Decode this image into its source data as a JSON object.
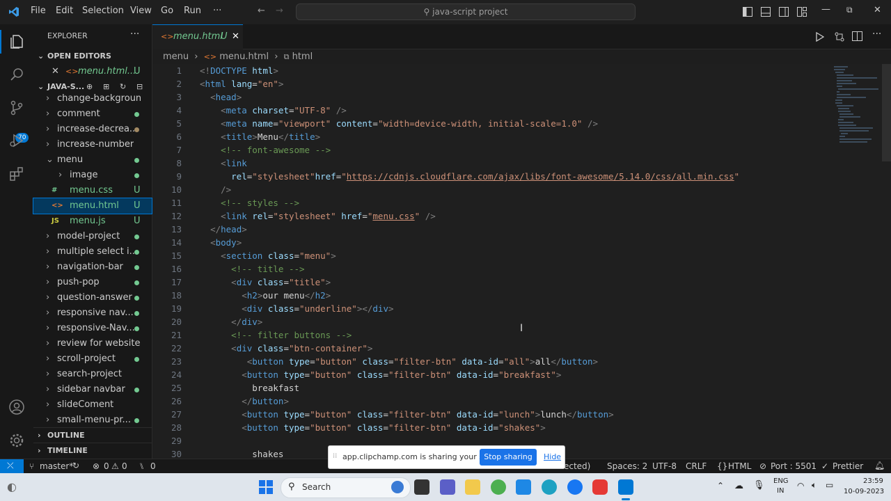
{
  "titlebar": {
    "menus": [
      "File",
      "Edit",
      "Selection",
      "View",
      "Go",
      "Run",
      "···"
    ],
    "search": "java-script project"
  },
  "sidebar": {
    "title": "EXPLORER",
    "more": "···",
    "open_editors": "OPEN EDITORS",
    "open_file": "menu.html...",
    "open_file_status": "U",
    "project": "JAVA-S...",
    "items": [
      {
        "label": "change-background-...",
        "indent": 0,
        "chev": ">"
      },
      {
        "label": "comment",
        "indent": 0,
        "chev": ">",
        "dot": "green"
      },
      {
        "label": "increase-decrea...",
        "indent": 0,
        "chev": ">",
        "dot": "brown"
      },
      {
        "label": "increase-number",
        "indent": 0,
        "chev": ">"
      },
      {
        "label": "menu",
        "indent": 0,
        "chev": "v",
        "dot": "green"
      },
      {
        "label": "image",
        "indent": 1,
        "chev": ">",
        "dot": "green"
      },
      {
        "label": "menu.css",
        "indent": 1,
        "icon": "#",
        "status": "U"
      },
      {
        "label": "menu.html",
        "indent": 1,
        "icon": "<>",
        "status": "U",
        "selected": true
      },
      {
        "label": "menu.js",
        "indent": 1,
        "icon": "JS",
        "status": "U"
      },
      {
        "label": "model-project",
        "indent": 0,
        "chev": ">",
        "dot": "green"
      },
      {
        "label": "multiple select i...",
        "indent": 0,
        "chev": ">",
        "dot": "green"
      },
      {
        "label": "navigation-bar",
        "indent": 0,
        "chev": ">",
        "dot": "green"
      },
      {
        "label": "push-pop",
        "indent": 0,
        "chev": ">",
        "dot": "green"
      },
      {
        "label": "question-answer",
        "indent": 0,
        "chev": ">",
        "dot": "green"
      },
      {
        "label": "responsive nav...",
        "indent": 0,
        "chev": ">",
        "dot": "green"
      },
      {
        "label": "responsive-Nav...",
        "indent": 0,
        "chev": ">",
        "dot": "green"
      },
      {
        "label": "review for website",
        "indent": 0,
        "chev": ">"
      },
      {
        "label": "scroll-project",
        "indent": 0,
        "chev": ">",
        "dot": "green"
      },
      {
        "label": "search-project",
        "indent": 0,
        "chev": ">"
      },
      {
        "label": "sidebar navbar",
        "indent": 0,
        "chev": ">",
        "dot": "green"
      },
      {
        "label": "slideComent",
        "indent": 0,
        "chev": ">"
      },
      {
        "label": "small-menu-pr...",
        "indent": 0,
        "chev": ">",
        "dot": "green"
      }
    ],
    "outline": "OUTLINE",
    "timeline": "TIMELINE"
  },
  "activity": {
    "badge": "70"
  },
  "tab": {
    "label": "menu.html",
    "status": "U",
    "close": "✕"
  },
  "breadcrumb": [
    "menu",
    "menu.html",
    "html"
  ],
  "code": [
    [
      [
        "br",
        "<!"
      ],
      [
        "tg",
        "DOCTYPE"
      ],
      [
        "tx",
        " "
      ],
      [
        "at",
        "html"
      ],
      [
        "br",
        ">"
      ]
    ],
    [
      [
        "br",
        "<"
      ],
      [
        "tg",
        "html"
      ],
      [
        "tx",
        " "
      ],
      [
        "at",
        "lang"
      ],
      [
        "tx",
        "="
      ],
      [
        "st",
        "\"en\""
      ],
      [
        "br",
        ">"
      ]
    ],
    [
      [
        "tx",
        "  "
      ],
      [
        "br",
        "<"
      ],
      [
        "tg",
        "head"
      ],
      [
        "br",
        ">"
      ]
    ],
    [
      [
        "tx",
        "    "
      ],
      [
        "br",
        "<"
      ],
      [
        "tg",
        "meta"
      ],
      [
        "tx",
        " "
      ],
      [
        "at",
        "charset"
      ],
      [
        "tx",
        "="
      ],
      [
        "st",
        "\"UTF-8\""
      ],
      [
        "tx",
        " "
      ],
      [
        "br",
        "/>"
      ]
    ],
    [
      [
        "tx",
        "    "
      ],
      [
        "br",
        "<"
      ],
      [
        "tg",
        "meta"
      ],
      [
        "tx",
        " "
      ],
      [
        "at",
        "name"
      ],
      [
        "tx",
        "="
      ],
      [
        "st",
        "\"viewport\""
      ],
      [
        "tx",
        " "
      ],
      [
        "at",
        "content"
      ],
      [
        "tx",
        "="
      ],
      [
        "st",
        "\"width=device-width, initial-scale=1.0\""
      ],
      [
        "tx",
        " "
      ],
      [
        "br",
        "/>"
      ]
    ],
    [
      [
        "tx",
        "    "
      ],
      [
        "br",
        "<"
      ],
      [
        "tg",
        "title"
      ],
      [
        "br",
        ">"
      ],
      [
        "tx",
        "Menu"
      ],
      [
        "br",
        "</"
      ],
      [
        "tg",
        "title"
      ],
      [
        "br",
        ">"
      ]
    ],
    [
      [
        "tx",
        "    "
      ],
      [
        "cm",
        "<!-- font-awesome -->"
      ]
    ],
    [
      [
        "tx",
        "    "
      ],
      [
        "br",
        "<"
      ],
      [
        "tg",
        "link"
      ]
    ],
    [
      [
        "tx",
        "      "
      ],
      [
        "at",
        "rel"
      ],
      [
        "tx",
        "="
      ],
      [
        "st",
        "\"stylesheet\""
      ],
      [
        "at",
        "href"
      ],
      [
        "tx",
        "="
      ],
      [
        "st",
        "\""
      ],
      [
        "link",
        "https://cdnjs.cloudflare.com/ajax/libs/font-awesome/5.14.0/css/all.min.css"
      ],
      [
        "st",
        "\""
      ]
    ],
    [
      [
        "tx",
        "    "
      ],
      [
        "br",
        "/>"
      ]
    ],
    [
      [
        "tx",
        "    "
      ],
      [
        "cm",
        "<!-- styles -->"
      ]
    ],
    [
      [
        "tx",
        "    "
      ],
      [
        "br",
        "<"
      ],
      [
        "tg",
        "link"
      ],
      [
        "tx",
        " "
      ],
      [
        "at",
        "rel"
      ],
      [
        "tx",
        "="
      ],
      [
        "st",
        "\"stylesheet\""
      ],
      [
        "tx",
        " "
      ],
      [
        "at",
        "href"
      ],
      [
        "tx",
        "="
      ],
      [
        "st",
        "\""
      ],
      [
        "link",
        "menu.css"
      ],
      [
        "st",
        "\""
      ],
      [
        "tx",
        " "
      ],
      [
        "br",
        "/>"
      ]
    ],
    [
      [
        "tx",
        "  "
      ],
      [
        "br",
        "</"
      ],
      [
        "tg",
        "head"
      ],
      [
        "br",
        ">"
      ]
    ],
    [
      [
        "tx",
        "  "
      ],
      [
        "br",
        "<"
      ],
      [
        "tg",
        "body"
      ],
      [
        "br",
        ">"
      ]
    ],
    [
      [
        "tx",
        "    "
      ],
      [
        "br",
        "<"
      ],
      [
        "tg",
        "section"
      ],
      [
        "tx",
        " "
      ],
      [
        "at",
        "class"
      ],
      [
        "tx",
        "="
      ],
      [
        "st",
        "\"menu\""
      ],
      [
        "br",
        ">"
      ]
    ],
    [
      [
        "tx",
        "      "
      ],
      [
        "cm",
        "<!-- title -->"
      ]
    ],
    [
      [
        "tx",
        "      "
      ],
      [
        "br",
        "<"
      ],
      [
        "tg",
        "div"
      ],
      [
        "tx",
        " "
      ],
      [
        "at",
        "class"
      ],
      [
        "tx",
        "="
      ],
      [
        "st",
        "\"title\""
      ],
      [
        "br",
        ">"
      ]
    ],
    [
      [
        "tx",
        "        "
      ],
      [
        "br",
        "<"
      ],
      [
        "tg",
        "h2"
      ],
      [
        "br",
        ">"
      ],
      [
        "tx",
        "our menu"
      ],
      [
        "br",
        "</"
      ],
      [
        "tg",
        "h2"
      ],
      [
        "br",
        ">"
      ]
    ],
    [
      [
        "tx",
        "        "
      ],
      [
        "br",
        "<"
      ],
      [
        "tg",
        "div"
      ],
      [
        "tx",
        " "
      ],
      [
        "at",
        "class"
      ],
      [
        "tx",
        "="
      ],
      [
        "st",
        "\"underline\""
      ],
      [
        "br",
        "></"
      ],
      [
        "tg",
        "div"
      ],
      [
        "br",
        ">"
      ]
    ],
    [
      [
        "tx",
        "      "
      ],
      [
        "br",
        "</"
      ],
      [
        "tg",
        "div"
      ],
      [
        "br",
        ">"
      ]
    ],
    [
      [
        "tx",
        "      "
      ],
      [
        "cm",
        "<!-- filter buttons -->"
      ]
    ],
    [
      [
        "tx",
        "      "
      ],
      [
        "br",
        "<"
      ],
      [
        "tg",
        "div"
      ],
      [
        "tx",
        " "
      ],
      [
        "at",
        "class"
      ],
      [
        "tx",
        "="
      ],
      [
        "st",
        "\"btn-container\""
      ],
      [
        "br",
        ">"
      ]
    ],
    [
      [
        "tx",
        "         "
      ],
      [
        "br",
        "<"
      ],
      [
        "tg",
        "button"
      ],
      [
        "tx",
        " "
      ],
      [
        "at",
        "type"
      ],
      [
        "tx",
        "="
      ],
      [
        "st",
        "\"button\""
      ],
      [
        "tx",
        " "
      ],
      [
        "at",
        "class"
      ],
      [
        "tx",
        "="
      ],
      [
        "st",
        "\"filter-btn\""
      ],
      [
        "tx",
        " "
      ],
      [
        "at",
        "data-id"
      ],
      [
        "tx",
        "="
      ],
      [
        "st",
        "\"all\""
      ],
      [
        "br",
        ">"
      ],
      [
        "tx",
        "all"
      ],
      [
        "br",
        "</"
      ],
      [
        "tg",
        "button"
      ],
      [
        "br",
        ">"
      ]
    ],
    [
      [
        "tx",
        "        "
      ],
      [
        "br",
        "<"
      ],
      [
        "tg",
        "button"
      ],
      [
        "tx",
        " "
      ],
      [
        "at",
        "type"
      ],
      [
        "tx",
        "="
      ],
      [
        "st",
        "\"button\""
      ],
      [
        "tx",
        " "
      ],
      [
        "at",
        "class"
      ],
      [
        "tx",
        "="
      ],
      [
        "st",
        "\"filter-btn\""
      ],
      [
        "tx",
        " "
      ],
      [
        "at",
        "data-id"
      ],
      [
        "tx",
        "="
      ],
      [
        "st",
        "\"breakfast\""
      ],
      [
        "br",
        ">"
      ]
    ],
    [
      [
        "tx",
        "          breakfast"
      ]
    ],
    [
      [
        "tx",
        "        "
      ],
      [
        "br",
        "</"
      ],
      [
        "tg",
        "button"
      ],
      [
        "br",
        ">"
      ]
    ],
    [
      [
        "tx",
        "        "
      ],
      [
        "br",
        "<"
      ],
      [
        "tg",
        "button"
      ],
      [
        "tx",
        " "
      ],
      [
        "at",
        "type"
      ],
      [
        "tx",
        "="
      ],
      [
        "st",
        "\"button\""
      ],
      [
        "tx",
        " "
      ],
      [
        "at",
        "class"
      ],
      [
        "tx",
        "="
      ],
      [
        "st",
        "\"filter-btn\""
      ],
      [
        "tx",
        " "
      ],
      [
        "at",
        "data-id"
      ],
      [
        "tx",
        "="
      ],
      [
        "st",
        "\"lunch\""
      ],
      [
        "br",
        ">"
      ],
      [
        "tx",
        "lunch"
      ],
      [
        "br",
        "</"
      ],
      [
        "tg",
        "button"
      ],
      [
        "br",
        ">"
      ]
    ],
    [
      [
        "tx",
        "        "
      ],
      [
        "br",
        "<"
      ],
      [
        "tg",
        "button"
      ],
      [
        "tx",
        " "
      ],
      [
        "at",
        "type"
      ],
      [
        "tx",
        "="
      ],
      [
        "st",
        "\"button\""
      ],
      [
        "tx",
        " "
      ],
      [
        "at",
        "class"
      ],
      [
        "tx",
        "="
      ],
      [
        "st",
        "\"filter-btn\""
      ],
      [
        "tx",
        " "
      ],
      [
        "at",
        "data-id"
      ],
      [
        "tx",
        "="
      ],
      [
        "st",
        "\"shakes\""
      ],
      [
        "br",
        ">"
      ]
    ],
    [],
    [
      [
        "tx",
        "          shakes"
      ]
    ]
  ],
  "statusbar": {
    "branch": "master*",
    "errors": "0",
    "warnings": "0",
    "ports_count": "0",
    "selection": "selected)",
    "spaces": "Spaces: 2",
    "encoding": "UTF-8",
    "eol": "CRLF",
    "language": "HTML",
    "port": "Port : 5501",
    "prettier": "Prettier"
  },
  "share": {
    "message": "app.clipchamp.com is sharing your screen.",
    "stop": "Stop sharing",
    "hide": "Hide"
  },
  "taskbar": {
    "search": "Search",
    "lang1": "ENG",
    "lang2": "IN",
    "time": "23:59",
    "date": "10-09-2023"
  },
  "colors": {
    "accent": "#0078d4",
    "share_button": "#1a73e8"
  }
}
